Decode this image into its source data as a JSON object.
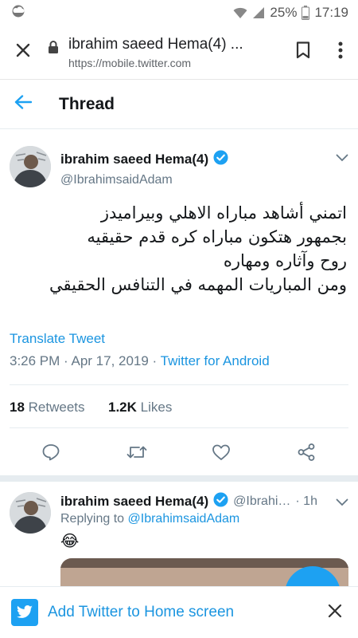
{
  "status_bar": {
    "battery_percent": "25%",
    "time": "17:19",
    "icons": [
      "cloud-icon",
      "wifi-icon",
      "signal-icon",
      "battery-icon"
    ]
  },
  "browser": {
    "title": "ibrahim saeed Hema(4) ...",
    "url": "https://mobile.twitter.com",
    "icons": [
      "close-icon",
      "lock-icon",
      "bookmark-icon",
      "more-vert-icon"
    ]
  },
  "header": {
    "title": "Thread",
    "back_icon": "back-arrow-icon"
  },
  "main_tweet": {
    "display_name": "ibrahim saeed Hema(4)",
    "handle": "@IbrahimsaidAdam",
    "verified_icon": "verified-badge-icon",
    "menu_icon": "chevron-down-icon",
    "text_lines": [
      "اتمني أشاهد مباراه الاهلي وبيراميدز",
      "بجمهور هتكون مباراه كره قدم حقيقيه",
      "روح وآثاره ومهاره",
      "ومن المباريات المهمه في التنافس الحقيقي"
    ],
    "translate_label": "Translate Tweet",
    "timestamp": "3:26 PM · Apr 17, 2019 · ",
    "source": "Twitter for Android",
    "retweets_count": "18",
    "retweets_label": "Retweets",
    "likes_count": "1.2K",
    "likes_label": "Likes",
    "action_icons": [
      "reply-icon",
      "retweet-icon",
      "like-icon",
      "share-icon"
    ]
  },
  "reply_tweet": {
    "display_name": "ibrahim saeed Hema(4)",
    "handle": "@Ibrahi…",
    "time": "· 1h",
    "replying_prefix": "Replying to ",
    "replying_to": "@IbrahimsaidAdam",
    "emoji": "😂"
  },
  "banner": {
    "text": "Add Twitter to Home screen",
    "icons": [
      "twitter-bird-icon",
      "close-icon"
    ]
  },
  "colors": {
    "twitter_blue": "#1da1f2",
    "link_blue": "#1b95e0",
    "gray_text": "#657786",
    "dark_text": "#14171a"
  }
}
